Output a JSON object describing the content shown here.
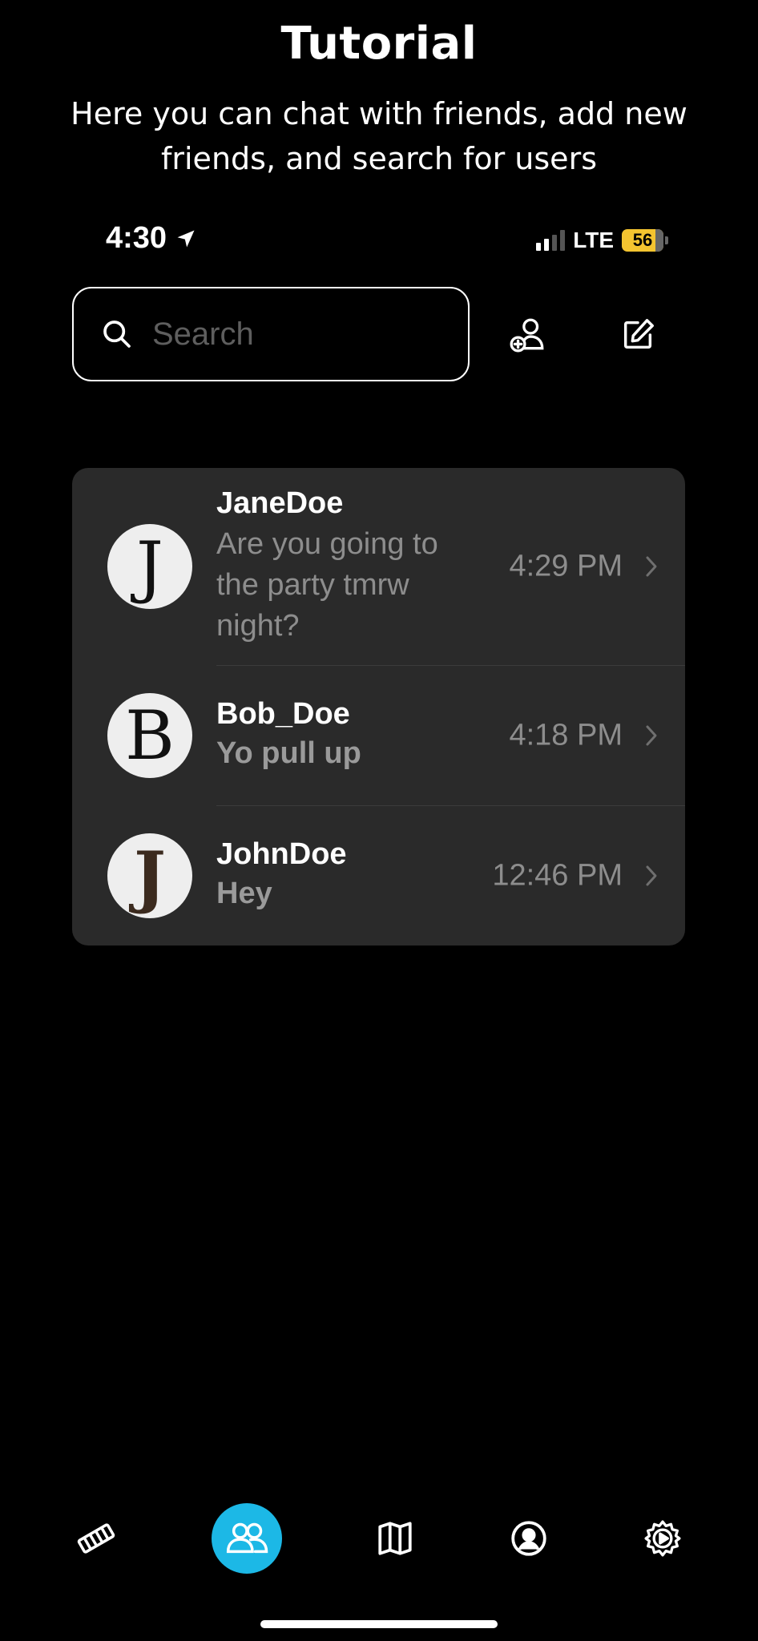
{
  "tutorial": {
    "title": "Tutorial",
    "subtitle": "Here you can chat with friends, add new friends, and search for users"
  },
  "status_bar": {
    "time": "4:30",
    "network": "LTE",
    "battery": "56"
  },
  "search": {
    "placeholder": "Search"
  },
  "chats": [
    {
      "name": "JaneDoe",
      "initial": "J",
      "message": "Are you going to the party tmrw night?",
      "time": "4:29 PM"
    },
    {
      "name": "Bob_Doe",
      "initial": "B",
      "message": "Yo pull up",
      "time": "4:18 PM"
    },
    {
      "name": "JohnDoe",
      "initial": "J",
      "message": "Hey",
      "time": "12:46 PM"
    }
  ],
  "tabs": [
    {
      "icon": "film-icon"
    },
    {
      "icon": "friends-icon",
      "active": true
    },
    {
      "icon": "map-icon"
    },
    {
      "icon": "profile-icon"
    },
    {
      "icon": "settings-icon"
    }
  ],
  "colors": {
    "accent": "#1cb8e6",
    "battery": "#f4c430",
    "card": "#2a2a2a"
  }
}
